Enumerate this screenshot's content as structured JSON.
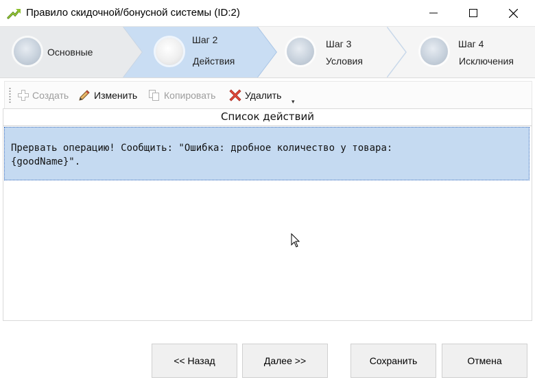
{
  "window": {
    "title": "Правило скидочной/бонусной системы (ID:2)",
    "icon": "arrow-icon",
    "controls": [
      "minimize-icon",
      "maximize-icon",
      "close-icon"
    ]
  },
  "steps": [
    {
      "title": "",
      "label": "Основные",
      "active": false
    },
    {
      "title": "Шаг 2",
      "label": "Действия",
      "active": true
    },
    {
      "title": "Шаг 3",
      "label": "Условия",
      "active": false
    },
    {
      "title": "Шаг 4",
      "label": "Исключения",
      "active": false
    }
  ],
  "toolbar": {
    "create_label": "Создать",
    "edit_label": "Изменить",
    "copy_label": "Копировать",
    "delete_label": "Удалить",
    "more_icon": "▾"
  },
  "list": {
    "header": "Список действий",
    "rows": [
      "Прервать операцию! Сообщить: \"Ошибка: дробное количество у товара:\n{goodName}\"."
    ]
  },
  "buttons": {
    "back_label": "<< Назад",
    "next_label": "Далее >>",
    "save_label": "Сохранить",
    "cancel_label": "Отмена"
  },
  "colors": {
    "selected_row": "#c5daf1",
    "active_step": "#c9ddf3",
    "inactive_step": "#f3f3f3"
  }
}
